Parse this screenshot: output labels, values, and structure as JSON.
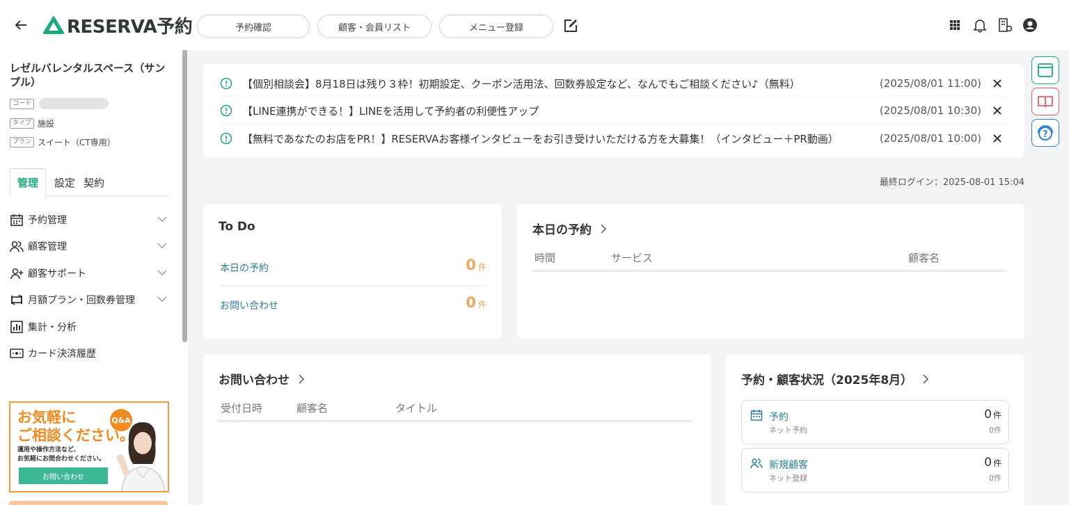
{
  "header": {
    "brand": "RESERVA予約",
    "nav": [
      "予約確認",
      "顧客・会員リスト",
      "メニュー登録"
    ]
  },
  "sidebar": {
    "shop_name": "レゼルバレンタルスペース（サンプル）",
    "meta": {
      "code_tag": "コード",
      "type_tag": "タイプ",
      "type_value": "施設",
      "plan_tag": "プラン",
      "plan_value": "スイート（CT専用）"
    },
    "tabs": [
      "管理",
      "設定",
      "契約"
    ],
    "menu": [
      {
        "label": "予約管理",
        "icon": "calendar-icon",
        "expandable": true
      },
      {
        "label": "顧客管理",
        "icon": "users-icon",
        "expandable": true
      },
      {
        "label": "顧客サポート",
        "icon": "user-plus-icon",
        "expandable": true
      },
      {
        "label": "月額プラン・回数券管理",
        "icon": "repeat-icon",
        "expandable": true
      },
      {
        "label": "集計・分析",
        "icon": "chart-icon",
        "expandable": false
      },
      {
        "label": "カード決済履歴",
        "icon": "card-icon",
        "expandable": false
      }
    ],
    "banner": {
      "line1": "お気軽に",
      "line2": "ご相談ください。",
      "badge": "Q&A",
      "sub1": "運用や操作方法など、",
      "sub2": "お気軽にお問合わせください。",
      "button": "お問い合わせ"
    }
  },
  "notices": [
    {
      "text": "【個別相談会】8月18日は残り３枠！初期設定、クーポン活用法、回数券設定など、なんでもご相談ください♪（無料）",
      "date": "(2025/08/01 11:00)"
    },
    {
      "text": "【LINE連携ができる！】LINEを活用して予約者の利便性アップ",
      "date": "(2025/08/01 10:30)"
    },
    {
      "text": "【無料であなたのお店をPR！】RESERVAお客様インタビューをお引き受けいただける方を大募集！（インタビュー＋PR動画）",
      "date": "(2025/08/01 10:00)"
    }
  ],
  "last_login": "最終ログイン：2025-08-01 15:04",
  "todo": {
    "title": "To Do",
    "rows": [
      {
        "label": "本日の予約",
        "count": "0",
        "unit": "件"
      },
      {
        "label": "お問い合わせ",
        "count": "0",
        "unit": "件"
      }
    ]
  },
  "today": {
    "title": "本日の予約",
    "columns": [
      "時間",
      "サービス",
      "顧客名"
    ]
  },
  "inquiry": {
    "title": "お問い合わせ",
    "columns": [
      "受付日時",
      "顧客名",
      "タイトル"
    ]
  },
  "status": {
    "title": "予約・顧客状況（2025年8月）",
    "items": [
      {
        "label": "予約",
        "sub": "ネット予約",
        "count": "0",
        "unit": "件",
        "sub_count": "0件"
      },
      {
        "label": "新規顧客",
        "sub": "ネット登録",
        "count": "0",
        "unit": "件",
        "sub_count": "0件"
      }
    ]
  },
  "colors": {
    "brand": "#1aa87c",
    "link": "#2a7f9a",
    "count": "#f0a45c",
    "banner": "#f08a1e"
  }
}
